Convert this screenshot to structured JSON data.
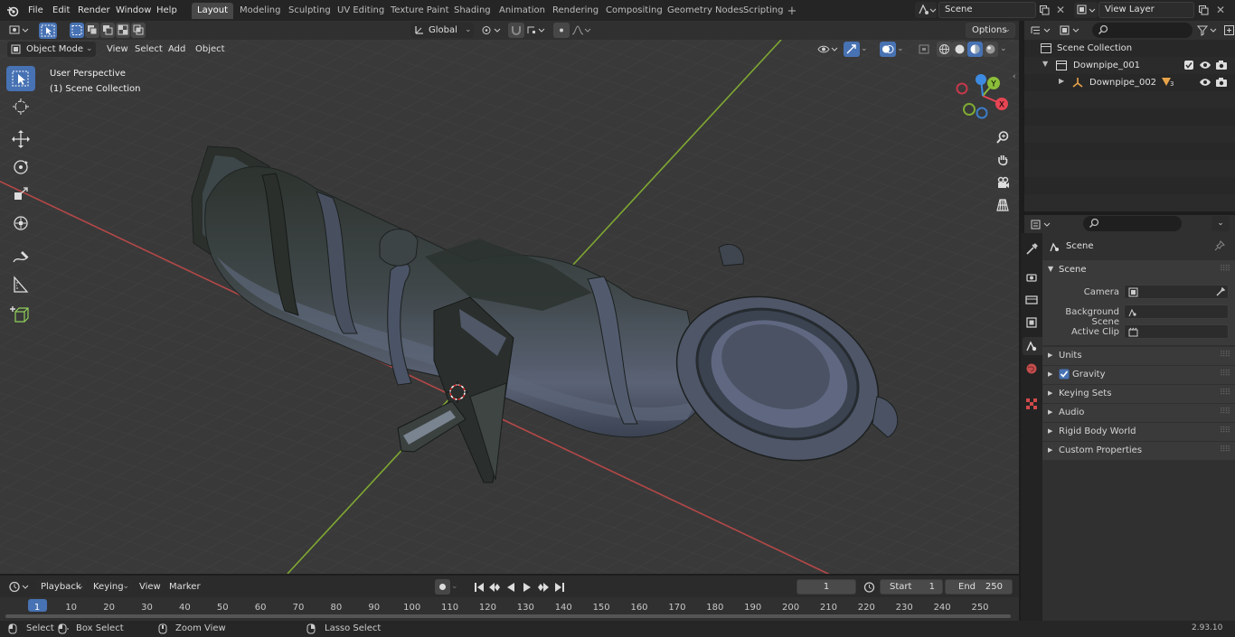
{
  "topbar": {
    "menus": [
      "File",
      "Edit",
      "Render",
      "Window",
      "Help"
    ],
    "workspaces": [
      "Layout",
      "Modeling",
      "Sculpting",
      "UV Editing",
      "Texture Paint",
      "Shading",
      "Animation",
      "Rendering",
      "Compositing",
      "Geometry Nodes",
      "Scripting"
    ],
    "active_workspace": "Layout",
    "scene": "Scene",
    "view_layer": "View Layer"
  },
  "viewport": {
    "mode": "Object Mode",
    "menus": [
      "View",
      "Select",
      "Add",
      "Object"
    ],
    "transform_orientation": "Global",
    "options": "Options",
    "overlay_line1": "User Perspective",
    "overlay_line2": "(1) Scene Collection",
    "gizmo_x": "X",
    "gizmo_y": "Y",
    "tools": [
      "select-box",
      "cursor",
      "move",
      "rotate",
      "scale",
      "transform",
      "annotate",
      "measure",
      "add-cube"
    ]
  },
  "outliner": {
    "root": "Scene Collection",
    "items": [
      {
        "name": "Downpipe_001",
        "level": 1
      },
      {
        "name": "Downpipe_002",
        "level": 2,
        "badge": "3"
      }
    ]
  },
  "properties": {
    "context": "Scene",
    "section": "Scene",
    "fields": [
      {
        "label": "Camera",
        "value": ""
      },
      {
        "label": "Background Scene",
        "value": ""
      },
      {
        "label": "Active Clip",
        "value": ""
      }
    ],
    "panels": [
      "Units",
      "Gravity",
      "Keying Sets",
      "Audio",
      "Rigid Body World",
      "Custom Properties"
    ]
  },
  "timeline": {
    "menus": [
      "Playback",
      "Keying",
      "View",
      "Marker"
    ],
    "current_frame": "1",
    "start_label": "Start",
    "start": "1",
    "end_label": "End",
    "end": "250",
    "ticks": [
      "1",
      "10",
      "20",
      "30",
      "40",
      "50",
      "60",
      "70",
      "80",
      "90",
      "100",
      "110",
      "120",
      "130",
      "140",
      "150",
      "160",
      "170",
      "180",
      "190",
      "200",
      "210",
      "220",
      "230",
      "240",
      "250"
    ]
  },
  "statusbar": {
    "select": "Select",
    "box_select": "Box Select",
    "zoom_view": "Zoom View",
    "lasso_select": "Lasso Select",
    "version": "2.93.10"
  },
  "colors": {
    "accent": "#4772b3",
    "x_axis": "#b54848",
    "y_axis": "#7fa832",
    "gizmo_x": "#e64554",
    "gizmo_y": "#8bbd3a",
    "gizmo_z": "#3d8be0"
  }
}
